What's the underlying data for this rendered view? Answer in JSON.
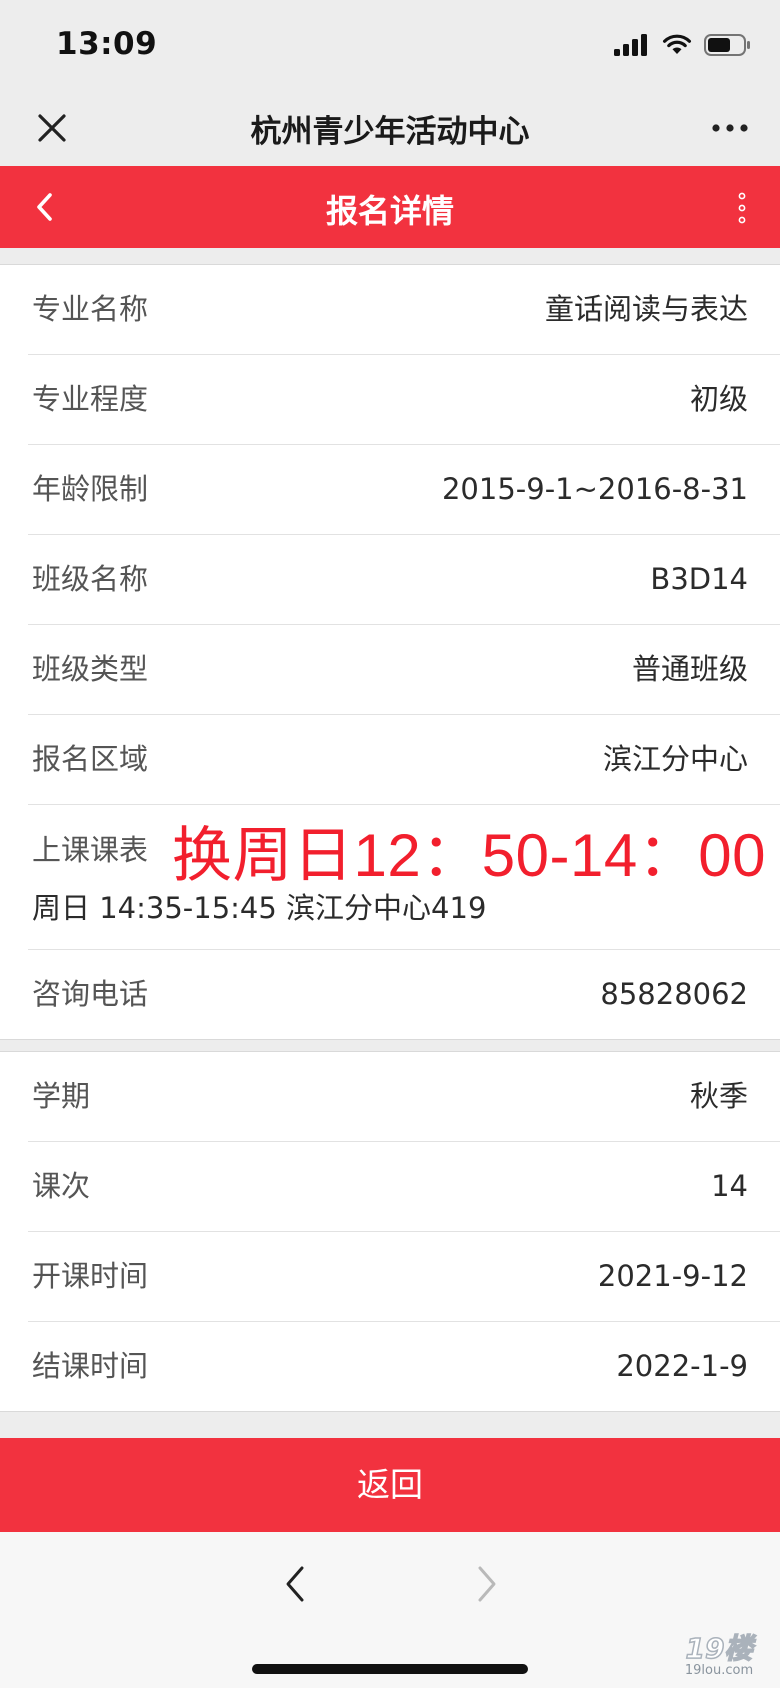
{
  "status_bar": {
    "time": "13:09"
  },
  "wechat_bar": {
    "title": "杭州青少年活动中心"
  },
  "page_header": {
    "title": "报名详情"
  },
  "course_details": [
    {
      "label": "专业名称",
      "value": "童话阅读与表达"
    },
    {
      "label": "专业程度",
      "value": "初级"
    },
    {
      "label": "年龄限制",
      "value": "2015-9-1~2016-8-31"
    },
    {
      "label": "班级名称",
      "value": "B3D14"
    },
    {
      "label": "班级类型",
      "value": "普通班级"
    },
    {
      "label": "报名区域",
      "value": "滨江分中心"
    }
  ],
  "schedule": {
    "label": "上课课表",
    "detail": "周日 14:35-15:45 滨江分中心419",
    "overlay_note": "换周日12：50-14：00"
  },
  "consult_phone": {
    "label": "咨询电话",
    "value": "85828062"
  },
  "term_details": [
    {
      "label": "学期",
      "value": "秋季"
    },
    {
      "label": "课次",
      "value": "14"
    },
    {
      "label": "开课时间",
      "value": "2021-9-12"
    },
    {
      "label": "结课时间",
      "value": "2022-1-9"
    }
  ],
  "back_button": {
    "label": "返回"
  },
  "watermark": {
    "main": "19楼",
    "sub": "19lou.com"
  },
  "colors": {
    "accent": "#f2323f",
    "overlay_text": "#f21f2d",
    "background": "#ededed"
  }
}
